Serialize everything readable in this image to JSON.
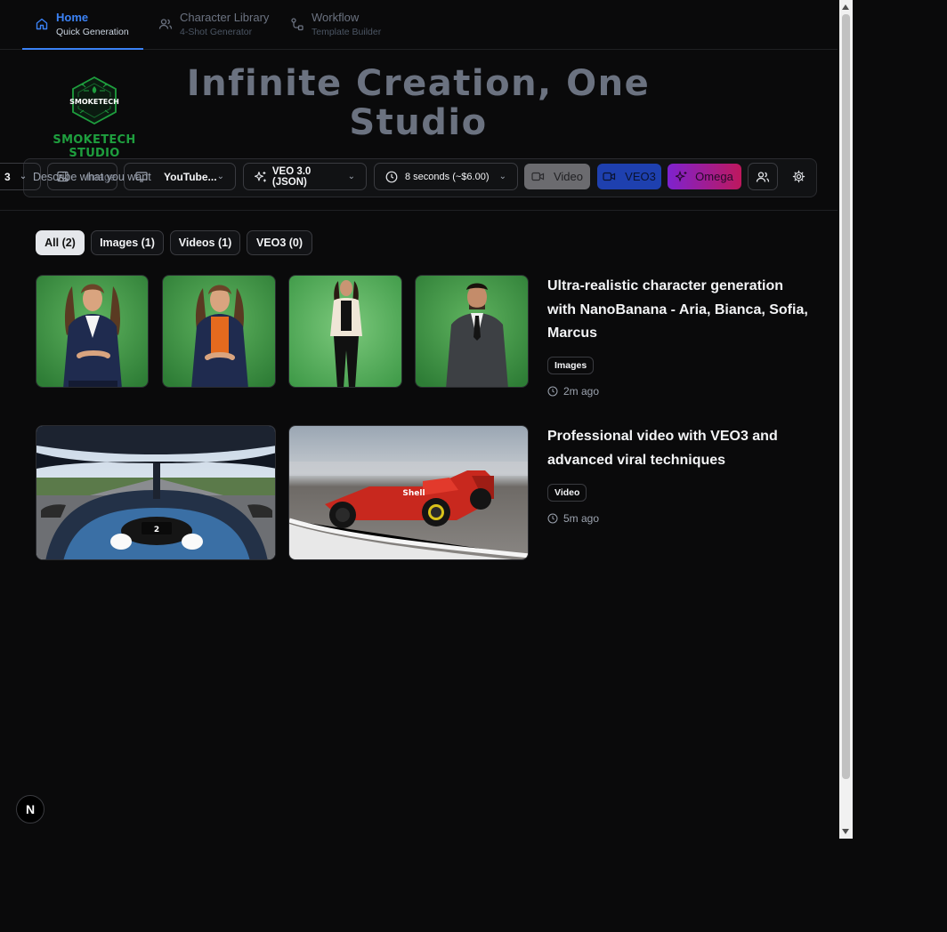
{
  "nav": {
    "tabs": [
      {
        "label": "Home",
        "sublabel": "Quick Generation",
        "icon": "home-icon",
        "active": true
      },
      {
        "label": "Character Library",
        "sublabel": "4-Shot Generator",
        "icon": "users-icon",
        "active": false
      },
      {
        "label": "Workflow",
        "sublabel": "Template Builder",
        "icon": "workflow-icon",
        "active": false
      }
    ]
  },
  "hero": {
    "logo_badge_text": "SMOKETECH",
    "logo_name": "SMOKETECH STUDIO",
    "title_line1": "Infinite Creation, One",
    "title_line2": "Studio"
  },
  "toolbar": {
    "count": "3",
    "prompt_placeholder": "Describe what you want",
    "image_label": "Image",
    "platform": "YouTube...",
    "model": "VEO 3.0 (JSON)",
    "duration": "8 seconds (~$6.00)",
    "mode_video": "Video",
    "mode_veo3": "VEO3",
    "mode_omega": "Omega"
  },
  "filters": [
    {
      "label": "All (2)",
      "active": true
    },
    {
      "label": "Images (1)",
      "active": false
    },
    {
      "label": "Videos (1)",
      "active": false
    },
    {
      "label": "VEO3 (0)",
      "active": false
    }
  ],
  "gallery": [
    {
      "title": "Ultra-realistic character generation with NanoBanana - Aria, Bianca, Sofia, Marcus",
      "badge": "Images",
      "time": "2m ago"
    },
    {
      "title": "Professional video with VEO3 and advanced viral techniques",
      "badge": "Video",
      "time": "5m ago"
    }
  ],
  "dev_badge": "N",
  "colors": {
    "accent": "#3b82f6",
    "brand_green": "#1e9e3e",
    "veo3_button": "#1e40af",
    "omega_start": "#7e22ce",
    "omega_end": "#be185d",
    "background": "#0a0a0b"
  }
}
